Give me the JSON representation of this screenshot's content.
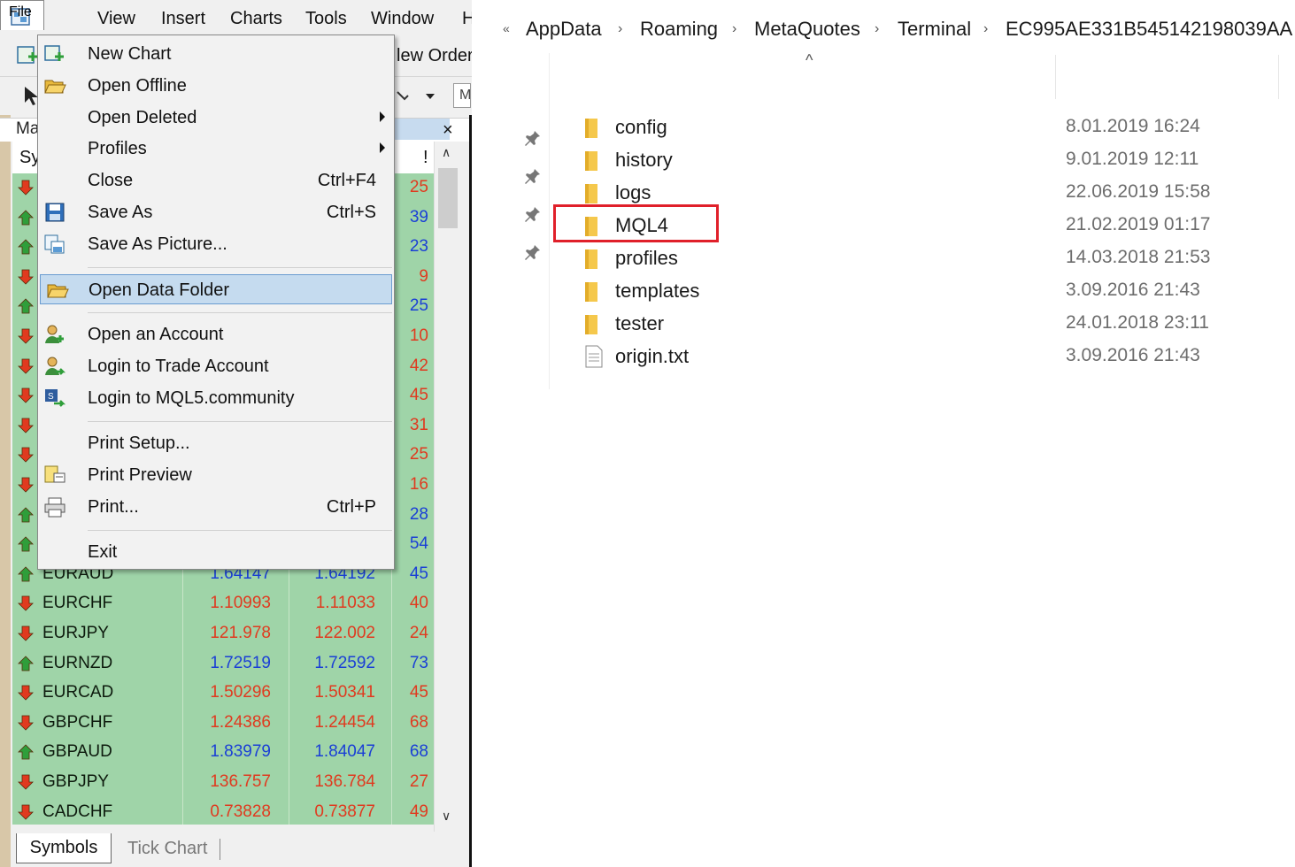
{
  "mt4": {
    "menubar": [
      "File",
      "View",
      "Insert",
      "Charts",
      "Tools",
      "Window",
      "H"
    ],
    "toolbar": {
      "new_order_label": "lew Order",
      "m_label": "M"
    },
    "market_watch": {
      "title": "Ma",
      "close": "×",
      "col_symbol": "Sy",
      "col_spread": "!"
    },
    "rows": [
      {
        "symbol": "",
        "bid": "",
        "ask": "",
        "spread": "25",
        "dir": "down",
        "color": "red"
      },
      {
        "symbol": "",
        "bid": "",
        "ask": "",
        "spread": "39",
        "dir": "up",
        "color": "blue"
      },
      {
        "symbol": "",
        "bid": "",
        "ask": "",
        "spread": "23",
        "dir": "up",
        "color": "blue"
      },
      {
        "symbol": "",
        "bid": "",
        "ask": "",
        "spread": "9",
        "dir": "down",
        "color": "red"
      },
      {
        "symbol": "",
        "bid": "",
        "ask": "",
        "spread": "25",
        "dir": "up",
        "color": "blue"
      },
      {
        "symbol": "",
        "bid": "",
        "ask": "",
        "spread": "10",
        "dir": "down",
        "color": "red"
      },
      {
        "symbol": "",
        "bid": "",
        "ask": "",
        "spread": "42",
        "dir": "down",
        "color": "red"
      },
      {
        "symbol": "",
        "bid": "",
        "ask": "",
        "spread": "45",
        "dir": "down",
        "color": "red"
      },
      {
        "symbol": "",
        "bid": "",
        "ask": "",
        "spread": "31",
        "dir": "down",
        "color": "red"
      },
      {
        "symbol": "",
        "bid": "",
        "ask": "",
        "spread": "25",
        "dir": "down",
        "color": "red"
      },
      {
        "symbol": "",
        "bid": "",
        "ask": "",
        "spread": "16",
        "dir": "down",
        "color": "red"
      },
      {
        "symbol": "",
        "bid": "",
        "ask": "",
        "spread": "28",
        "dir": "up",
        "color": "blue"
      },
      {
        "symbol": "",
        "bid": "",
        "ask": "",
        "spread": "54",
        "dir": "up",
        "color": "blue"
      },
      {
        "symbol": "EURAUD",
        "bid": "1.64147",
        "ask": "1.64192",
        "spread": "45",
        "dir": "up",
        "color": "blue"
      },
      {
        "symbol": "EURCHF",
        "bid": "1.10993",
        "ask": "1.11033",
        "spread": "40",
        "dir": "down",
        "color": "red"
      },
      {
        "symbol": "EURJPY",
        "bid": "121.978",
        "ask": "122.002",
        "spread": "24",
        "dir": "down",
        "color": "red"
      },
      {
        "symbol": "EURNZD",
        "bid": "1.72519",
        "ask": "1.72592",
        "spread": "73",
        "dir": "up",
        "color": "blue"
      },
      {
        "symbol": "EURCAD",
        "bid": "1.50296",
        "ask": "1.50341",
        "spread": "45",
        "dir": "down",
        "color": "red"
      },
      {
        "symbol": "GBPCHF",
        "bid": "1.24386",
        "ask": "1.24454",
        "spread": "68",
        "dir": "down",
        "color": "red"
      },
      {
        "symbol": "GBPAUD",
        "bid": "1.83979",
        "ask": "1.84047",
        "spread": "68",
        "dir": "up",
        "color": "blue"
      },
      {
        "symbol": "GBPJPY",
        "bid": "136.757",
        "ask": "136.784",
        "spread": "27",
        "dir": "down",
        "color": "red"
      },
      {
        "symbol": "CADCHF",
        "bid": "0.73828",
        "ask": "0.73877",
        "spread": "49",
        "dir": "down",
        "color": "red"
      }
    ],
    "tabs": {
      "symbols": "Symbols",
      "tick_chart": "Tick Chart"
    },
    "file_menu": [
      {
        "label": "New Chart",
        "shortcut": "",
        "submenu": false,
        "icon": "new-chart-icon"
      },
      {
        "label": "Open Offline",
        "shortcut": "",
        "submenu": false,
        "icon": "open-folder-icon"
      },
      {
        "label": "Open Deleted",
        "shortcut": "",
        "submenu": true,
        "icon": ""
      },
      {
        "label": "Profiles",
        "shortcut": "",
        "submenu": true,
        "icon": ""
      },
      {
        "label": "Close",
        "shortcut": "Ctrl+F4",
        "submenu": false,
        "icon": ""
      },
      {
        "label": "Save As",
        "shortcut": "Ctrl+S",
        "submenu": false,
        "icon": "floppy-disk-icon"
      },
      {
        "label": "Save As Picture...",
        "shortcut": "",
        "submenu": false,
        "icon": "save-picture-icon"
      },
      {
        "label": "Open Data Folder",
        "shortcut": "",
        "submenu": false,
        "icon": "open-folder-icon",
        "highlighted": true
      },
      {
        "label": "Open an Account",
        "shortcut": "",
        "submenu": false,
        "icon": "user-add-icon"
      },
      {
        "label": "Login to Trade Account",
        "shortcut": "",
        "submenu": false,
        "icon": "user-login-icon"
      },
      {
        "label": "Login to MQL5.community",
        "shortcut": "",
        "submenu": false,
        "icon": "mql5-login-icon"
      },
      {
        "label": "Print Setup...",
        "shortcut": "",
        "submenu": false,
        "icon": ""
      },
      {
        "label": "Print Preview",
        "shortcut": "",
        "submenu": false,
        "icon": "print-preview-icon"
      },
      {
        "label": "Print...",
        "shortcut": "Ctrl+P",
        "submenu": false,
        "icon": "printer-icon"
      },
      {
        "label": "Exit",
        "shortcut": "",
        "submenu": false,
        "icon": ""
      }
    ]
  },
  "explorer": {
    "breadcrumb": [
      "AppData",
      "Roaming",
      "MetaQuotes",
      "Terminal",
      "EC995AE331B545142198039AA"
    ],
    "overflow": "«",
    "sort_caret": "^",
    "items": [
      {
        "name": "config",
        "date": "8.01.2019 16:24",
        "type": "folder"
      },
      {
        "name": "history",
        "date": "9.01.2019 12:11",
        "type": "folder"
      },
      {
        "name": "logs",
        "date": "22.06.2019 15:58",
        "type": "folder"
      },
      {
        "name": "MQL4",
        "date": "21.02.2019 01:17",
        "type": "folder",
        "highlighted": true
      },
      {
        "name": "profiles",
        "date": "14.03.2018 21:53",
        "type": "folder"
      },
      {
        "name": "templates",
        "date": "3.09.2016 21:43",
        "type": "folder"
      },
      {
        "name": "tester",
        "date": "24.01.2018 23:11",
        "type": "folder"
      },
      {
        "name": "origin.txt",
        "date": "3.09.2016 21:43",
        "type": "file"
      }
    ],
    "highlight_color": "#e0202a"
  },
  "colors": {
    "up_blue": "#1a3fd6",
    "down_red": "#e03a1f",
    "table_green": "#9fd4a8",
    "menu_highlight": "#c5dbef",
    "folder_yellow": "#f5c84c"
  }
}
